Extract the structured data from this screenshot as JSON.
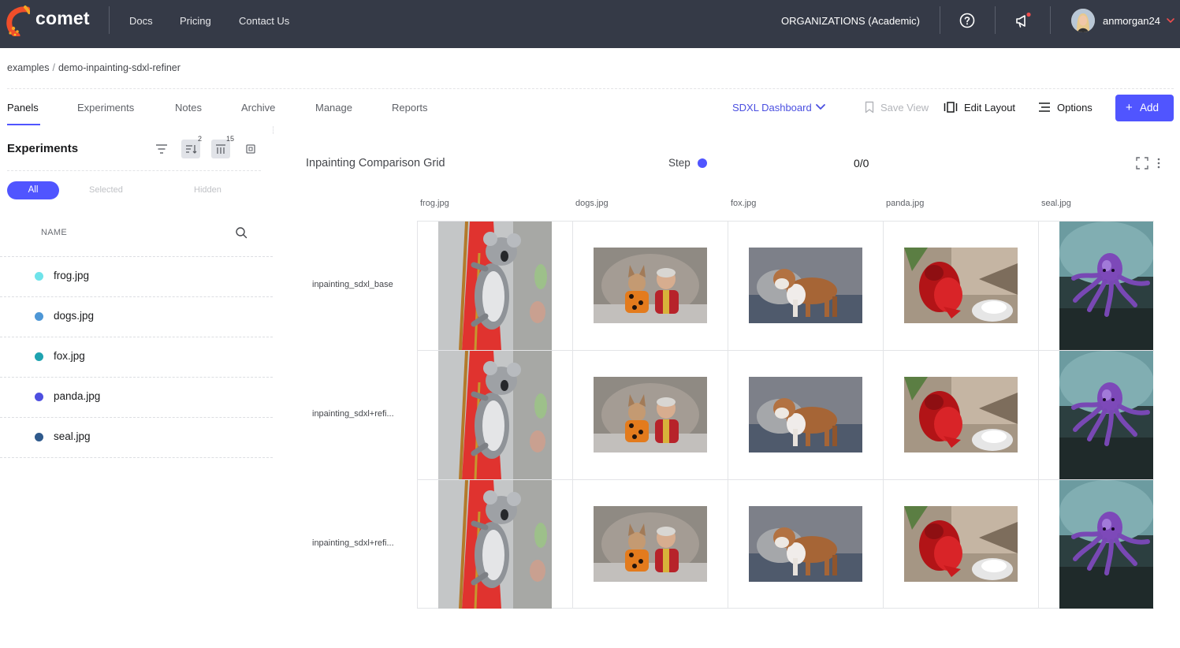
{
  "app": {
    "logo_text": "comet",
    "nav": [
      "Docs",
      "Pricing",
      "Contact Us"
    ],
    "organization": "ORGANIZATIONS (Academic)",
    "username": "anmorgan24",
    "icons": [
      "comet-logo-icon",
      "help-icon",
      "megaphone-icon",
      "avatar",
      "chevron-down-icon"
    ],
    "colors": {
      "topbar": "#353a47",
      "accent": "#5055ff",
      "notification": "#f04e4e"
    }
  },
  "breadcrumb": {
    "workspace": "examples",
    "separator": "/",
    "project": "demo-inpainting-sdxl-refiner"
  },
  "tabs": [
    "Panels",
    "Experiments",
    "Notes",
    "Archive",
    "Manage",
    "Reports"
  ],
  "active_tab": "Panels",
  "toolbar": {
    "dashboard": "SDXL Dashboard",
    "save_view": "Save View",
    "edit_layout": "Edit Layout",
    "options": "Options",
    "add": "Add",
    "add_icon": "+"
  },
  "sidebar": {
    "title": "Experiments",
    "sort_badge": "2",
    "columns_badge": "15",
    "segments": [
      "All",
      "Selected",
      "Hidden"
    ],
    "name_header": "NAME",
    "experiments": [
      {
        "name": "frog.jpg",
        "color": "#6fe3ea"
      },
      {
        "name": "dogs.jpg",
        "color": "#4e97d6"
      },
      {
        "name": "fox.jpg",
        "color": "#1fa3b0"
      },
      {
        "name": "panda.jpg",
        "color": "#4e4fe0"
      },
      {
        "name": "seal.jpg",
        "color": "#2f5a8c"
      }
    ]
  },
  "panel": {
    "title": "Inpainting Comparison Grid",
    "step_label": "Step",
    "step_value": "0/0",
    "columns": [
      "frog.jpg",
      "dogs.jpg",
      "fox.jpg",
      "panda.jpg",
      "seal.jpg"
    ],
    "rows": [
      "inpainting_sdxl_base",
      "inpainting_sdxl+refi...",
      "inpainting_sdxl+refi..."
    ],
    "images": [
      "koala-image",
      "dogs-costume-image",
      "bulldog-image",
      "red-panda-sculpture-image",
      "octopus-image"
    ]
  }
}
